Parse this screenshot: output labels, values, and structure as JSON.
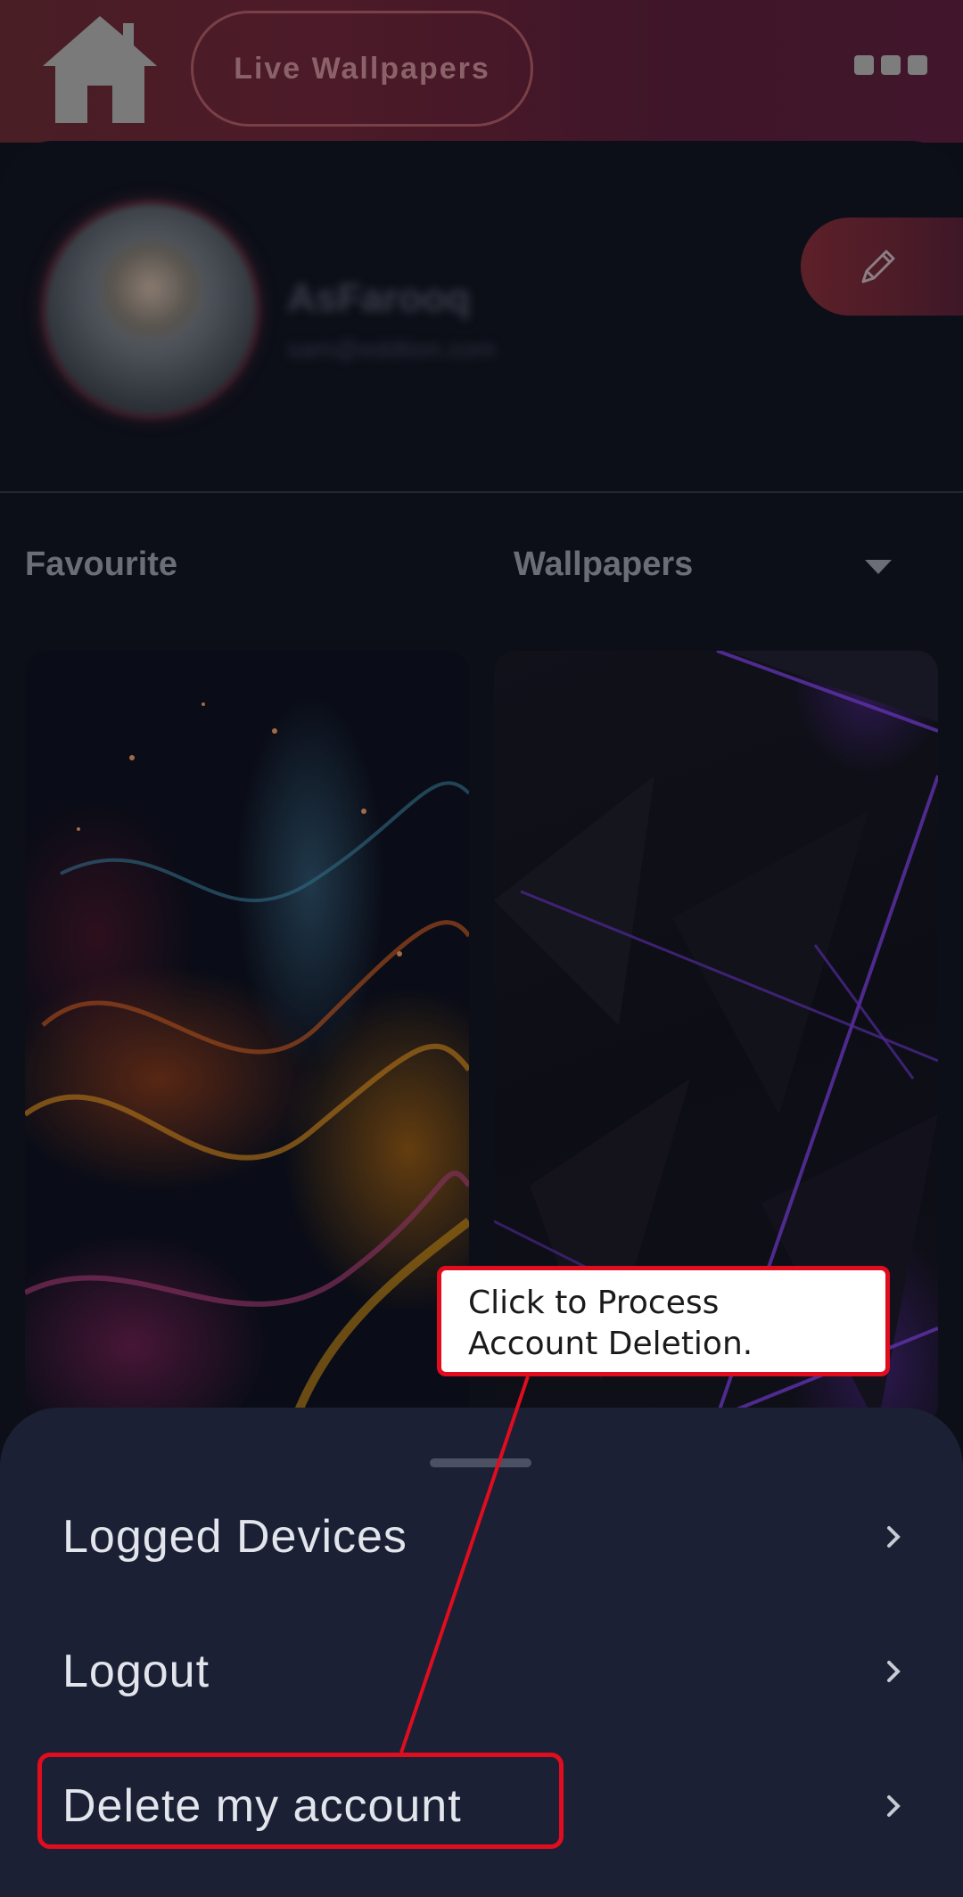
{
  "header": {
    "live_wallpapers_label": "Live Wallpapers",
    "home_icon": "home-icon",
    "menu_icon": "more-dots-icon"
  },
  "profile": {
    "name": "AsFarooq",
    "email": "sam@eddtion.com",
    "edit_icon": "pencil-icon"
  },
  "tabs": {
    "favourite": "Favourite",
    "wallpapers": "Wallpapers"
  },
  "wallpapers": [
    {
      "name": "abstract-smoke-wallpaper"
    },
    {
      "name": "purple-shards-wallpaper"
    }
  ],
  "sheet": {
    "items": [
      {
        "label": "Logged Devices"
      },
      {
        "label": "Logout"
      },
      {
        "label": "Delete my account"
      }
    ]
  },
  "annotation": {
    "callout_text": "Click to Process Account Deletion."
  },
  "colors": {
    "accent_red": "#e00d1f",
    "sheet_bg": "#1b2034",
    "page_bg": "#0c0f18"
  }
}
